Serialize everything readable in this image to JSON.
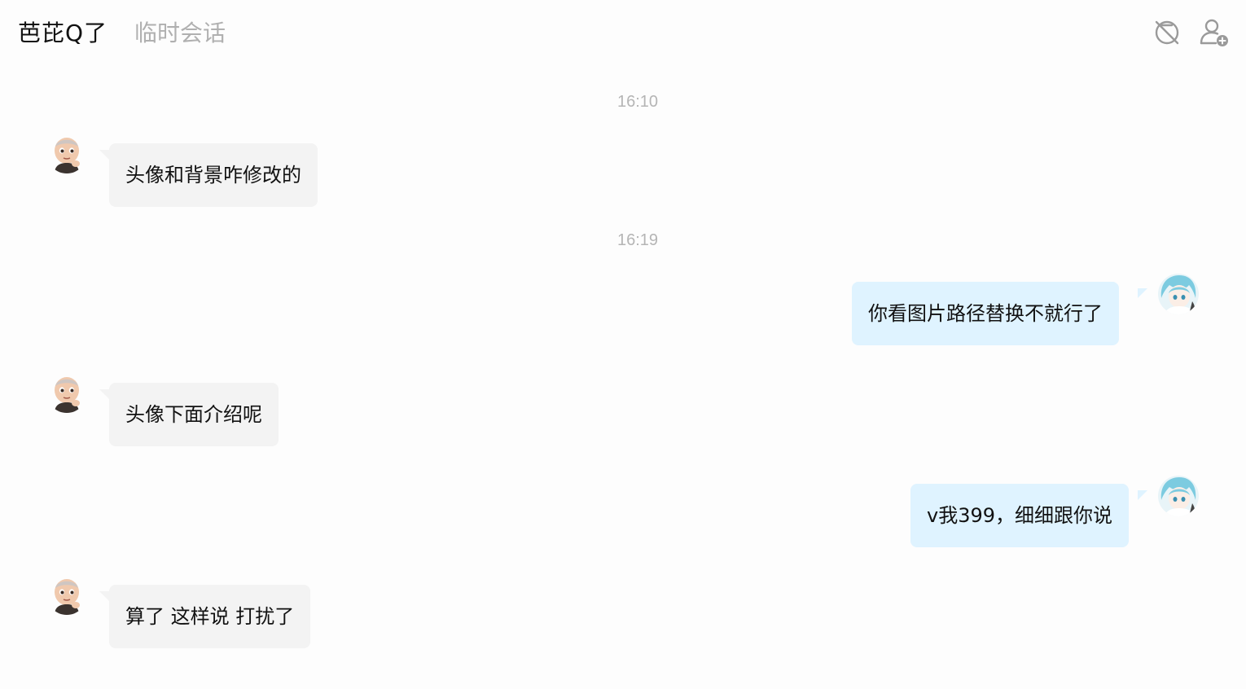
{
  "header": {
    "title": "芭芘Q了",
    "subtitle": "临时会话",
    "mute_icon": "no-disturb-icon",
    "add_icon": "add-friend-icon"
  },
  "timestamps": [
    "16:10",
    "16:19"
  ],
  "messages": [
    {
      "side": "in",
      "text": "头像和背景咋修改的"
    },
    {
      "side": "out",
      "text": "你看图片路径替换不就行了"
    },
    {
      "side": "in",
      "text": "头像下面介绍呢"
    },
    {
      "side": "out",
      "text": "v我399，细细跟你说"
    },
    {
      "side": "in",
      "text": "算了 这样说 打扰了"
    }
  ],
  "colors": {
    "incoming_bubble": "#f3f3f3",
    "outgoing_bubble": "#dff3ff",
    "timestamp": "#b5b5b5",
    "subtitle": "#b0b0b0"
  }
}
